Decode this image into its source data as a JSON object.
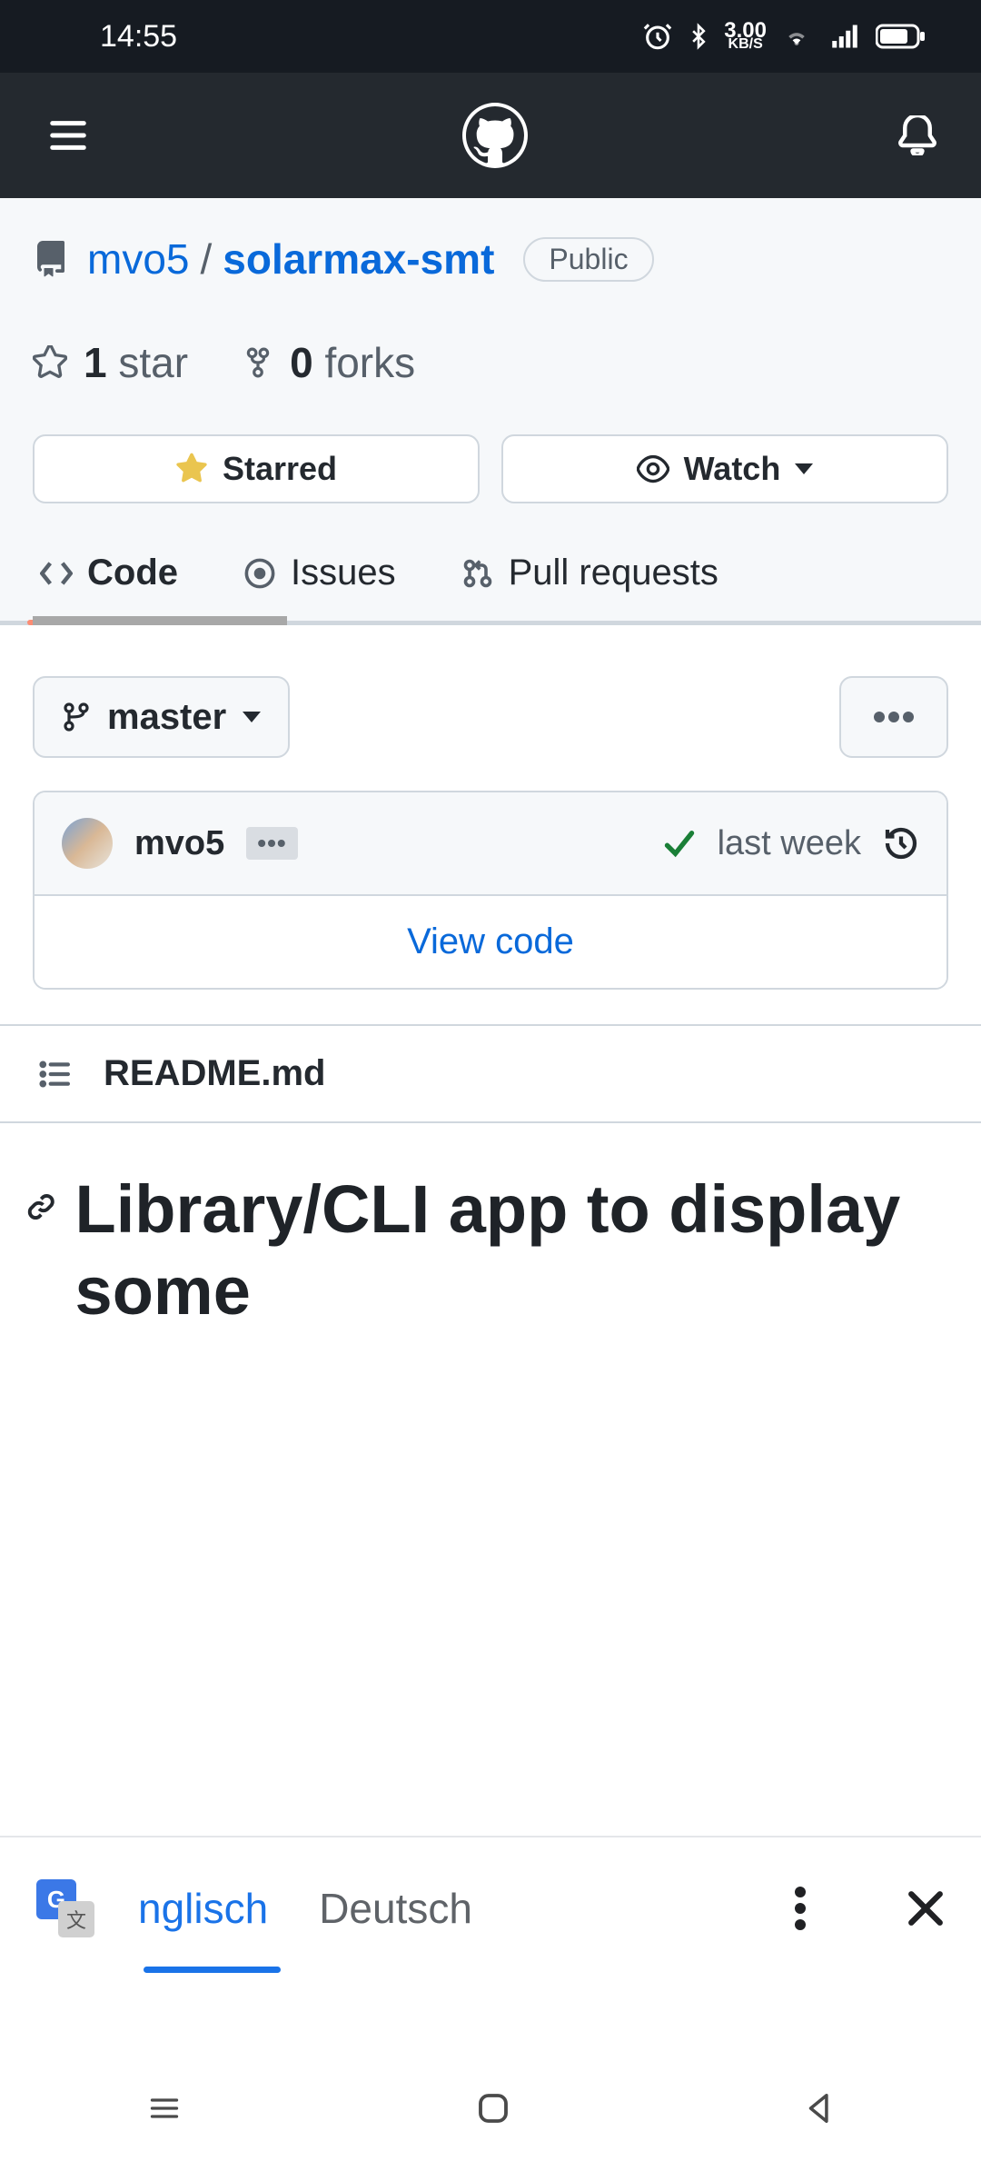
{
  "statusbar": {
    "time": "14:55",
    "net_speed": "3.00",
    "net_unit": "KB/S"
  },
  "repo": {
    "owner": "mvo5",
    "slash": "/",
    "name": "solarmax-smt",
    "visibility": "Public",
    "stars_count": "1",
    "stars_label": "star",
    "forks_count": "0",
    "forks_label": "forks",
    "starred_btn": "Starred",
    "watch_btn": "Watch"
  },
  "tabs": {
    "code": "Code",
    "issues": "Issues",
    "prs": "Pull requests"
  },
  "branch": {
    "name": "master"
  },
  "commit": {
    "author": "mvo5",
    "time": "last week",
    "view_code": "View code"
  },
  "readme": {
    "filename": "README.md",
    "heading": "Library/CLI app to display some"
  },
  "translate": {
    "lang_source": "nglisch",
    "lang_target": "Deutsch"
  }
}
